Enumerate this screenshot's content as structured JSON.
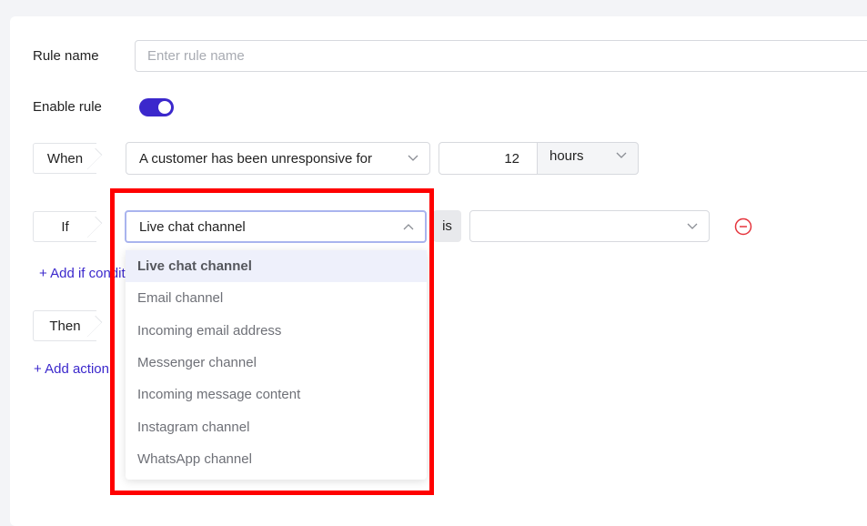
{
  "rule": {
    "name_label": "Rule name",
    "name_value": "",
    "name_placeholder": "Enter rule name",
    "enable_label": "Enable rule",
    "enabled": true
  },
  "when": {
    "tag": "When",
    "trigger": "A customer has been unresponsive for",
    "amount": "12",
    "unit": "hours"
  },
  "if": {
    "tag": "If",
    "field": "Live chat channel",
    "operator": "is",
    "value": "",
    "add_condition": "+ Add if condition"
  },
  "then": {
    "tag": "Then",
    "add_action": "+ Add action"
  },
  "dropdown": {
    "options": [
      "Live chat channel",
      "Email channel",
      "Incoming email address",
      "Messenger channel",
      "Incoming message content",
      "Instagram channel",
      "WhatsApp channel"
    ],
    "selected": "Live chat channel"
  },
  "colors": {
    "accent": "#3b28cc",
    "highlight": "#ff0000",
    "remove_icon": "#e5343c"
  }
}
